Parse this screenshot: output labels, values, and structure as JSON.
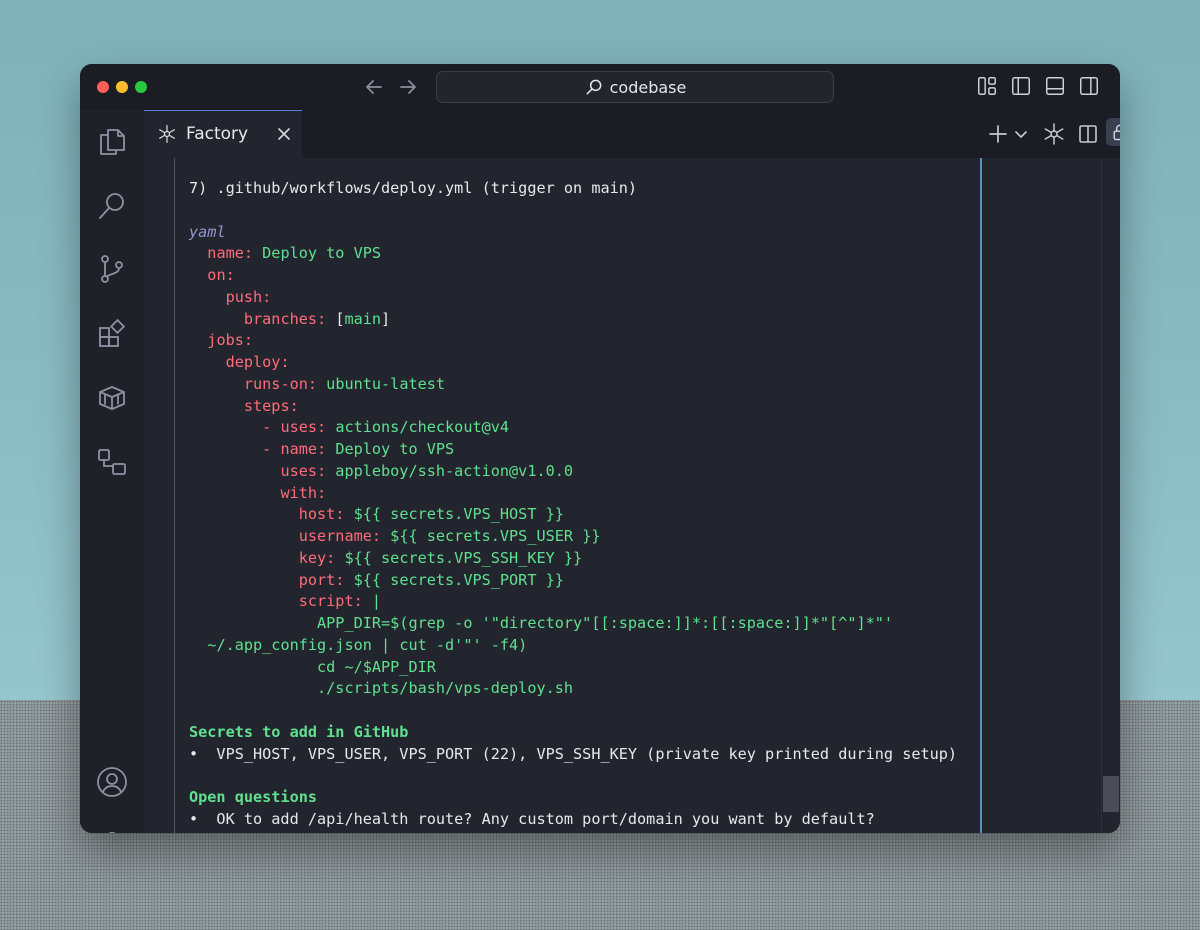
{
  "window": {
    "search_label": "codebase"
  },
  "tab": {
    "label": "Factory"
  },
  "code": {
    "heading": "7) .github/workflows/deploy.yml (trigger on main)",
    "lang": "yaml",
    "yaml": [
      {
        "indent": "  ",
        "key": "name:",
        "value": " Deploy to VPS"
      },
      {
        "indent": "  ",
        "key": "on:",
        "value": ""
      },
      {
        "indent": "    ",
        "key": "push:",
        "value": ""
      },
      {
        "indent": "      ",
        "key": "branches:",
        "pre": " [",
        "value": "main",
        "post": "]"
      },
      {
        "indent": "  ",
        "key": "jobs:",
        "value": ""
      },
      {
        "indent": "    ",
        "key": "deploy:",
        "value": ""
      },
      {
        "indent": "      ",
        "key": "runs-on:",
        "value": " ubuntu-latest"
      },
      {
        "indent": "      ",
        "key": "steps:",
        "value": ""
      },
      {
        "indent": "        ",
        "key": "- uses:",
        "value": " actions/checkout@v4"
      },
      {
        "indent": "        ",
        "key": "- name:",
        "value": " Deploy to VPS"
      },
      {
        "indent": "          ",
        "key": "uses:",
        "value": " appleboy/ssh-action@v1.0.0"
      },
      {
        "indent": "          ",
        "key": "with:",
        "value": ""
      },
      {
        "indent": "            ",
        "key": "host:",
        "value": " ${{ secrets.VPS_HOST }}"
      },
      {
        "indent": "            ",
        "key": "username:",
        "value": " ${{ secrets.VPS_USER }}"
      },
      {
        "indent": "            ",
        "key": "key:",
        "value": " ${{ secrets.VPS_SSH_KEY }}"
      },
      {
        "indent": "            ",
        "key": "port:",
        "value": " ${{ secrets.VPS_PORT }}"
      },
      {
        "indent": "            ",
        "key": "script:",
        "value": " |"
      },
      {
        "indent": "              ",
        "key": "",
        "value": "APP_DIR=$(grep -o '\"directory\"[[:space:]]*:[[:space:]]*\"[^\"]*\"'"
      },
      {
        "indent": "  ",
        "key": "",
        "value": "~/.app_config.json | cut -d'\"' -f4)"
      },
      {
        "indent": "              ",
        "key": "",
        "value": "cd ~/$APP_DIR"
      },
      {
        "indent": "              ",
        "key": "",
        "value": "./scripts/bash/vps-deploy.sh"
      }
    ],
    "secrets_heading": "Secrets to add in GitHub",
    "secrets_item": "•  VPS_HOST, VPS_USER, VPS_PORT (22), VPS_SSH_KEY (private key printed during setup)",
    "questions_heading": "Open questions",
    "questions_item": "•  OK to add /api/health route? Any custom port/domain you want by default?"
  },
  "colors": {
    "key": "#ff6b78",
    "value": "#5fe08f",
    "lang": "#8f95c8",
    "guide": "#4f95c4"
  }
}
